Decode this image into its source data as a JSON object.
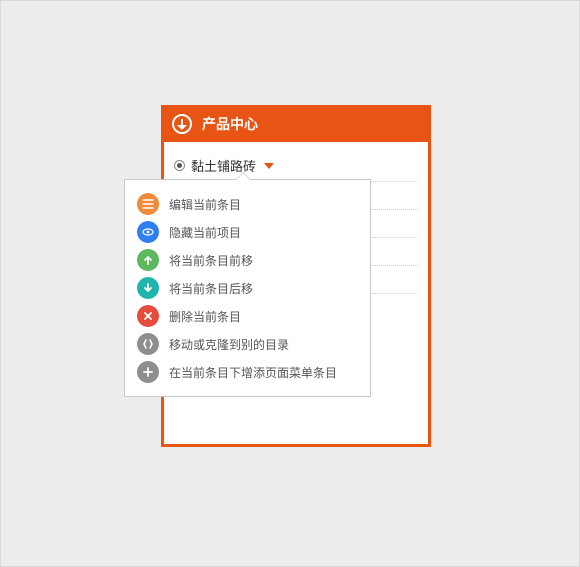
{
  "panel": {
    "title": "产品中心",
    "items": [
      {
        "label": "黏土铺路砖",
        "selected": true,
        "expanded": true
      }
    ]
  },
  "menu": {
    "items": [
      {
        "icon": "list",
        "color": "c-orange",
        "label": "编辑当前条目"
      },
      {
        "icon": "eye",
        "color": "c-blue",
        "label": "隐藏当前项目"
      },
      {
        "icon": "arrow-up",
        "color": "c-green",
        "label": "将当前条目前移"
      },
      {
        "icon": "arrow-down",
        "color": "c-teal",
        "label": "将当前条目后移"
      },
      {
        "icon": "close",
        "color": "c-red",
        "label": "删除当前条目"
      },
      {
        "icon": "move",
        "color": "c-gray",
        "label": "移动或克隆到别的目录"
      },
      {
        "icon": "plus",
        "color": "c-gray",
        "label": "在当前条目下增添页面菜单条目"
      }
    ]
  }
}
